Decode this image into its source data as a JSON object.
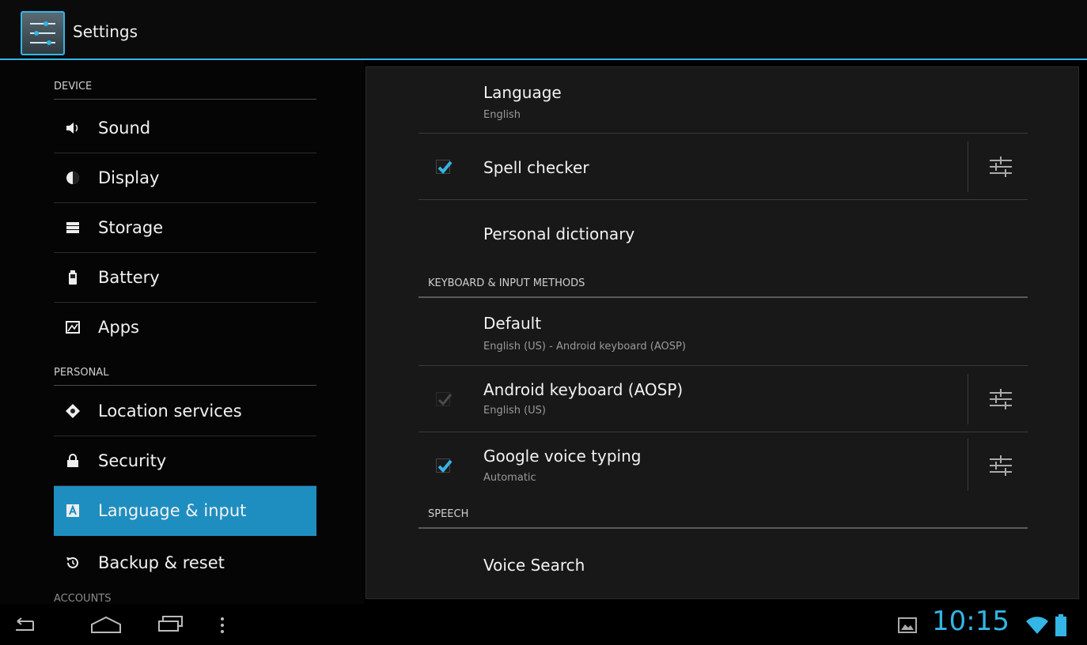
{
  "app": {
    "title": "Settings"
  },
  "sidebar": {
    "sections": [
      {
        "label": "DEVICE"
      },
      {
        "label": "PERSONAL"
      },
      {
        "label": "ACCOUNTS"
      }
    ],
    "items": [
      {
        "label": "Sound",
        "icon": "speaker-icon"
      },
      {
        "label": "Display",
        "icon": "brightness-icon"
      },
      {
        "label": "Storage",
        "icon": "storage-icon"
      },
      {
        "label": "Battery",
        "icon": "battery-icon"
      },
      {
        "label": "Apps",
        "icon": "apps-icon"
      },
      {
        "label": "Location services",
        "icon": "location-icon"
      },
      {
        "label": "Security",
        "icon": "lock-icon"
      },
      {
        "label": "Language & input",
        "icon": "language-icon",
        "selected": true
      },
      {
        "label": "Backup & reset",
        "icon": "backup-icon"
      }
    ]
  },
  "content": {
    "language": {
      "title": "Language",
      "summary": "English"
    },
    "spell_checker": {
      "title": "Spell checker",
      "checked": true
    },
    "personal_dictionary": {
      "title": "Personal dictionary"
    },
    "keyboard_section": "KEYBOARD & INPUT METHODS",
    "default_input": {
      "title": "Default",
      "summary": "English (US) - Android keyboard (AOSP)"
    },
    "android_keyboard": {
      "title": "Android keyboard (AOSP)",
      "summary": "English (US)",
      "checked": true,
      "disabled": true
    },
    "voice_typing": {
      "title": "Google voice typing",
      "summary": "Automatic",
      "checked": true
    },
    "speech_section": "SPEECH",
    "voice_search": {
      "title": "Voice Search"
    }
  },
  "status": {
    "time": "10:15"
  },
  "colors": {
    "accent": "#33b5e5",
    "selected": "#1e8ec0"
  }
}
